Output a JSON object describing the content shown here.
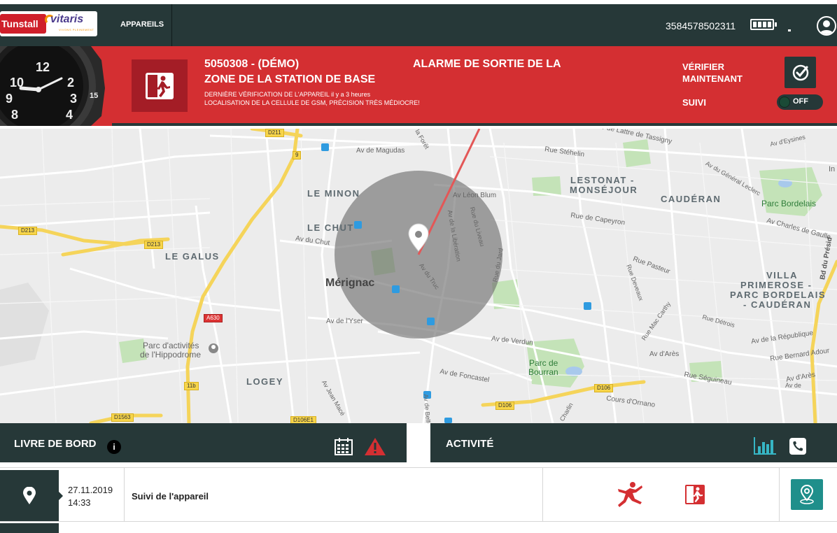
{
  "header": {
    "logo_brand": "Tunstall",
    "logo_product": "vitaris",
    "logo_tagline": "VIVONS PLEINEMENT",
    "nav_appareils": "APPAREILS",
    "phone_number": "3584578502311",
    "signal_text": "."
  },
  "alarm": {
    "device_line1": "5050308 - (DÉMO)",
    "device_line2": "ZONE DE LA STATION DE BASE",
    "title": "ALARME DE SORTIE DE LA",
    "last_check": "DERNIÈRE VÉRIFICATION DE L'APPAREIL il y a 3 heures",
    "location_note": "LOCALISATION DE LA CELLULE DE GSM, PRÉCISION TRÈS MÉDIOCRE!",
    "verify_line1": "VÉRIFIER",
    "verify_line2": "MAINTENANT",
    "suivi_label": "SUIVI",
    "suivi_state": "OFF"
  },
  "watch": {
    "numbers": [
      "12",
      "10",
      "2",
      "9",
      "3",
      "8",
      "4",
      "15"
    ]
  },
  "map": {
    "labels": {
      "le_minon": "LE MINON",
      "le_chut": "LE CHUT",
      "le_galus": "LE GALUS",
      "merignac": "Mérignac",
      "logey": "LOGEY",
      "lestonat": "LESTONAT -",
      "monsejour": "MONSÉJOUR",
      "cauderan": "CAUDÉRAN",
      "villa1": "VILLA",
      "villa2": "PRIMEROSE -",
      "villa3": "PARC BORDELAIS",
      "villa4": "- CAUDÉRAN",
      "parc_bordelais": "Parc Bordelais",
      "parc_hippo1": "Parc d'activités",
      "parc_hippo2": "de l'Hippodrome",
      "parc_bourran1": "Parc de",
      "parc_bourran2": "Bourran",
      "av_magudas": "Av de Magudas",
      "av_leon_blum": "Av Léon Blum",
      "av_du_chut": "Av du Chut",
      "av_lyser": "Av de l'Yser",
      "av_verdun": "Av de Verdun",
      "av_foncastel": "Av de Foncastel",
      "av_du_truc": "Av du Truc",
      "rue_stehelin": "Rue Stéhelin",
      "rue_capeyron": "Rue de Capeyron",
      "rue_pasteur": "Rue Pasteur",
      "cours_ornano": "Cours d'Ornano",
      "av_republique": "Av de la République",
      "rue_bernard_adour": "Rue Bernard Adour",
      "av_ares1": "Av d'Arès",
      "av_ares2": "Av d'Arès",
      "av_charles_gaulle": "Av Charles de Gaulle",
      "rue_segui": "Rue Séguineau",
      "av_lattre": "Av de Lattre de Tassigny",
      "av_general_leclerc": "Av du Général Leclerc",
      "av_eysines": "Av d'Eysines",
      "rue_detrois": "Rue Détrois",
      "rue_deveaux": "Rue Deveaux",
      "rue_mac_carthy": "Rue Mac Carthy",
      "rue_jard": "Rue du Jard",
      "rue_liveau": "Rue du Liveau",
      "av_liberation": "Av de la Libération",
      "av_jean_mace": "Av Jean Macé",
      "av_belfort": "Av de Belfort",
      "av_charlin": "Charlin",
      "bd_president": "Bd du Présid",
      "rue_foret": "la Forêt",
      "rue_in": "In",
      "av_de": "Av de"
    },
    "badges": {
      "d211": "D211",
      "d213a": "D213",
      "d213b": "D213",
      "a630": "A630",
      "d106a": "D106",
      "d106b": "D106",
      "d1563": "D1563",
      "d106e1": "D106E1",
      "r9": "9",
      "r11b": "11b"
    }
  },
  "logbook": {
    "title": "LIVRE DE BORD",
    "info_icon": "i"
  },
  "activity": {
    "title": "ACTIVITÉ"
  },
  "log_rows": [
    {
      "date": "27.11.2019",
      "time": "14:33",
      "event": "Suivi de l'appareil"
    }
  ],
  "colors": {
    "header_bg": "#263838",
    "alarm_red": "#d42f32",
    "alarm_dark_red": "#a41d26",
    "teal_action": "#1f8f8b",
    "icon_red": "#d42f32"
  }
}
